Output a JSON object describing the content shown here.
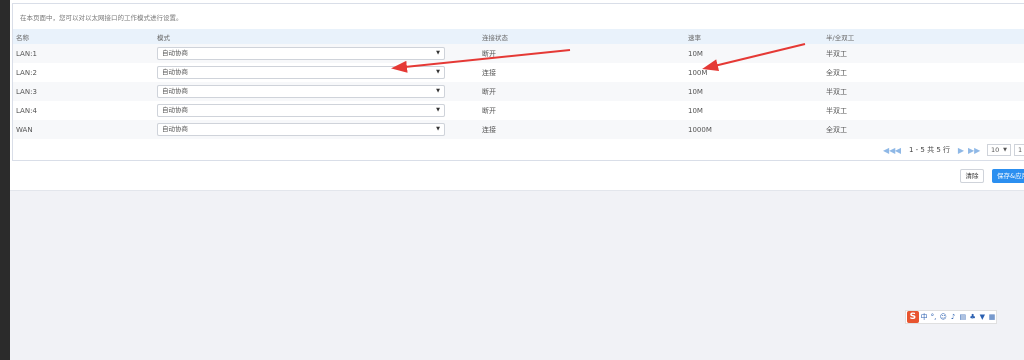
{
  "page": {
    "description": "在本页面中，您可以对以太网接口的工作模式进行设置。"
  },
  "table": {
    "headers": [
      "名称",
      "模式",
      "连接状态",
      "速率",
      "半/全双工"
    ],
    "rows": [
      {
        "name": "LAN:1",
        "mode": "自动协商",
        "status": "断开",
        "speed": "10M",
        "duplex": "半双工"
      },
      {
        "name": "LAN:2",
        "mode": "自动协商",
        "status": "连接",
        "speed": "100M",
        "duplex": "全双工"
      },
      {
        "name": "LAN:3",
        "mode": "自动协商",
        "status": "断开",
        "speed": "10M",
        "duplex": "半双工"
      },
      {
        "name": "LAN:4",
        "mode": "自动协商",
        "status": "断开",
        "speed": "10M",
        "duplex": "半双工"
      },
      {
        "name": "WAN",
        "mode": "自动协商",
        "status": "连接",
        "speed": "1000M",
        "duplex": "全双工"
      }
    ]
  },
  "pager": {
    "info": "1 - 5 共 5 行",
    "page_size": "10",
    "page_input": "1"
  },
  "buttons": {
    "clear": "清除",
    "save": "保存&应用"
  },
  "ime": {
    "label": "中"
  },
  "icons": {
    "select_caret": "triangle-down",
    "first": "double-left",
    "prev": "left",
    "next": "right",
    "last": "double-right"
  },
  "colors": {
    "header_bg": "#e9f2fb",
    "accent": "#2b8ff0",
    "arrow": "#e53935"
  }
}
